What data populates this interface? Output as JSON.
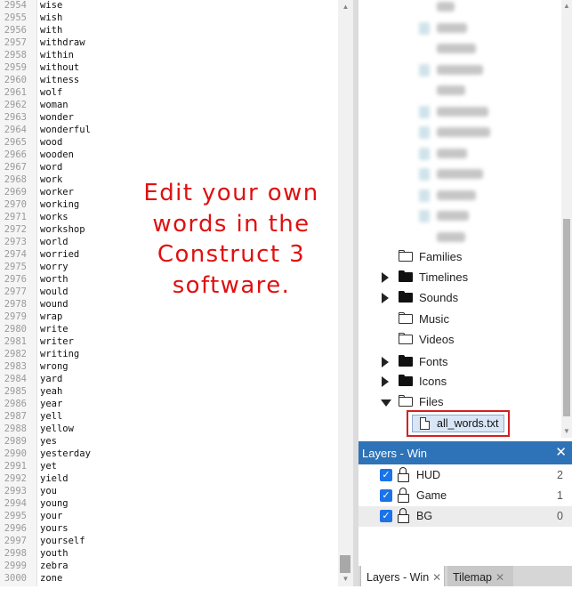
{
  "editor": {
    "lines": [
      {
        "n": "2954",
        "w": "wise"
      },
      {
        "n": "2955",
        "w": "wish"
      },
      {
        "n": "2956",
        "w": "with"
      },
      {
        "n": "2957",
        "w": "withdraw"
      },
      {
        "n": "2958",
        "w": "within"
      },
      {
        "n": "2959",
        "w": "without"
      },
      {
        "n": "2960",
        "w": "witness"
      },
      {
        "n": "2961",
        "w": "wolf"
      },
      {
        "n": "2962",
        "w": "woman"
      },
      {
        "n": "2963",
        "w": "wonder"
      },
      {
        "n": "2964",
        "w": "wonderful"
      },
      {
        "n": "2965",
        "w": "wood"
      },
      {
        "n": "2966",
        "w": "wooden"
      },
      {
        "n": "2967",
        "w": "word"
      },
      {
        "n": "2968",
        "w": "work"
      },
      {
        "n": "2969",
        "w": "worker"
      },
      {
        "n": "2970",
        "w": "working"
      },
      {
        "n": "2971",
        "w": "works"
      },
      {
        "n": "2972",
        "w": "workshop"
      },
      {
        "n": "2973",
        "w": "world"
      },
      {
        "n": "2974",
        "w": "worried"
      },
      {
        "n": "2975",
        "w": "worry"
      },
      {
        "n": "2976",
        "w": "worth"
      },
      {
        "n": "2977",
        "w": "would"
      },
      {
        "n": "2978",
        "w": "wound"
      },
      {
        "n": "2979",
        "w": "wrap"
      },
      {
        "n": "2980",
        "w": "write"
      },
      {
        "n": "2981",
        "w": "writer"
      },
      {
        "n": "2982",
        "w": "writing"
      },
      {
        "n": "2983",
        "w": "wrong"
      },
      {
        "n": "2984",
        "w": "yard"
      },
      {
        "n": "2985",
        "w": "yeah"
      },
      {
        "n": "2986",
        "w": "year"
      },
      {
        "n": "2987",
        "w": "yell"
      },
      {
        "n": "2988",
        "w": "yellow"
      },
      {
        "n": "2989",
        "w": "yes"
      },
      {
        "n": "2990",
        "w": "yesterday"
      },
      {
        "n": "2991",
        "w": "yet"
      },
      {
        "n": "2992",
        "w": "yield"
      },
      {
        "n": "2993",
        "w": "you"
      },
      {
        "n": "2994",
        "w": "young"
      },
      {
        "n": "2995",
        "w": "your"
      },
      {
        "n": "2996",
        "w": "yours"
      },
      {
        "n": "2997",
        "w": "yourself"
      },
      {
        "n": "2998",
        "w": "youth"
      },
      {
        "n": "2999",
        "w": "zebra"
      },
      {
        "n": "3000",
        "w": "zone"
      }
    ],
    "overlay_lines": [
      "Edit your own",
      "words in the",
      "Construct 3",
      "software."
    ],
    "overlay_color": "#e01010"
  },
  "project": {
    "folders": [
      {
        "label": "Families",
        "state": "none",
        "icon": "folder-open-icon"
      },
      {
        "label": "Timelines",
        "state": "collapsed",
        "icon": "folder-filled-icon"
      },
      {
        "label": "Sounds",
        "state": "collapsed",
        "icon": "folder-filled-icon"
      },
      {
        "label": "Music",
        "state": "none",
        "icon": "folder-open-icon"
      },
      {
        "label": "Videos",
        "state": "none",
        "icon": "folder-open-icon"
      },
      {
        "label": "Fonts",
        "state": "collapsed",
        "icon": "folder-filled-icon"
      },
      {
        "label": "Icons",
        "state": "collapsed",
        "icon": "folder-filled-icon"
      },
      {
        "label": "Files",
        "state": "expanded",
        "icon": "folder-open-icon"
      }
    ],
    "selected_file": "all_words.txt",
    "highlight_color": "#d42020"
  },
  "layers": {
    "title": "Layers - Win",
    "items": [
      {
        "name": "HUD",
        "index": "2",
        "visible": true
      },
      {
        "name": "Game",
        "index": "1",
        "visible": true
      },
      {
        "name": "BG",
        "index": "0",
        "visible": true
      }
    ]
  },
  "bottom_tabs": [
    {
      "label": "Layers - Win"
    },
    {
      "label": "Tilemap"
    }
  ],
  "accent_color": "#2e73b8"
}
